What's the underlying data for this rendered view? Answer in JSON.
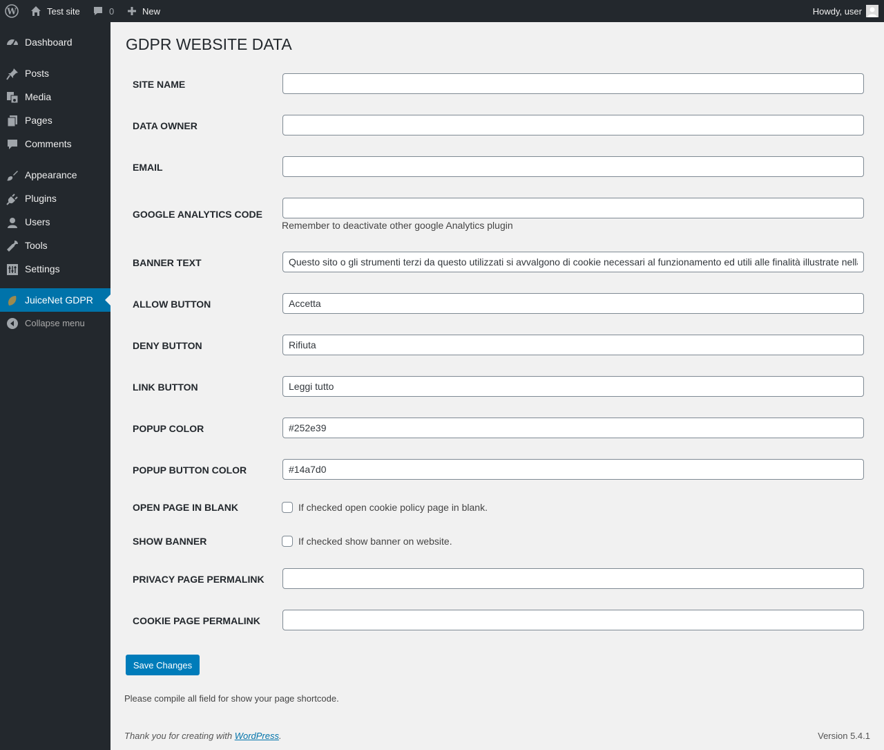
{
  "adminbar": {
    "site_name": "Test site",
    "comments_count": "0",
    "new_label": "New",
    "howdy": "Howdy, user"
  },
  "sidebar": {
    "items": [
      {
        "label": "Dashboard",
        "icon": "dashboard-icon"
      },
      {
        "label": "Posts",
        "icon": "pin-icon"
      },
      {
        "label": "Media",
        "icon": "media-icon"
      },
      {
        "label": "Pages",
        "icon": "pages-icon"
      },
      {
        "label": "Comments",
        "icon": "comment-icon"
      },
      {
        "label": "Appearance",
        "icon": "brush-icon"
      },
      {
        "label": "Plugins",
        "icon": "plug-icon"
      },
      {
        "label": "Users",
        "icon": "user-icon"
      },
      {
        "label": "Tools",
        "icon": "wrench-icon"
      },
      {
        "label": "Settings",
        "icon": "settings-icon"
      },
      {
        "label": "JuiceNet GDPR",
        "icon": "leaf-icon"
      },
      {
        "label": "Collapse menu",
        "icon": "collapse-icon"
      }
    ]
  },
  "page": {
    "title": "GDPR WEBSITE DATA",
    "fields": {
      "site_name": {
        "label": "SITE NAME",
        "value": ""
      },
      "data_owner": {
        "label": "DATA OWNER",
        "value": ""
      },
      "email": {
        "label": "EMAIL",
        "value": ""
      },
      "ga_code": {
        "label": "GOOGLE ANALYTICS CODE",
        "value": "",
        "description": "Remember to deactivate other google Analytics plugin"
      },
      "banner_text": {
        "label": "BANNER TEXT",
        "value": "Questo sito o gli strumenti terzi da questo utilizzati si avvalgono di cookie necessari al funzionamento ed utili alle finalità illustrate nella cookie policy."
      },
      "allow_button": {
        "label": "ALLOW BUTTON",
        "value": "Accetta"
      },
      "deny_button": {
        "label": "DENY BUTTON",
        "value": "Rifiuta"
      },
      "link_button": {
        "label": "LINK BUTTON",
        "value": "Leggi tutto"
      },
      "popup_color": {
        "label": "POPUP COLOR",
        "value": "#252e39"
      },
      "popup_button_color": {
        "label": "POPUP BUTTON COLOR",
        "value": "#14a7d0"
      },
      "open_blank": {
        "label": "OPEN PAGE IN BLANK",
        "checkbox_label": "If checked open cookie policy page in blank.",
        "checked": false
      },
      "show_banner": {
        "label": "SHOW BANNER",
        "checkbox_label": "If checked show banner on website.",
        "checked": false
      },
      "privacy_permalink": {
        "label": "PRIVACY PAGE PERMALINK",
        "value": ""
      },
      "cookie_permalink": {
        "label": "COOKIE PAGE PERMALINK",
        "value": ""
      }
    },
    "save_label": "Save Changes",
    "note": "Please compile all field for show your page shortcode."
  },
  "footer": {
    "thanks_prefix": "Thank you for creating with ",
    "thanks_link": "WordPress",
    "thanks_suffix": ".",
    "version": "Version 5.4.1"
  },
  "colors": {
    "adminbar_bg": "#23282d",
    "accent": "#0073aa",
    "button": "#007cba"
  }
}
